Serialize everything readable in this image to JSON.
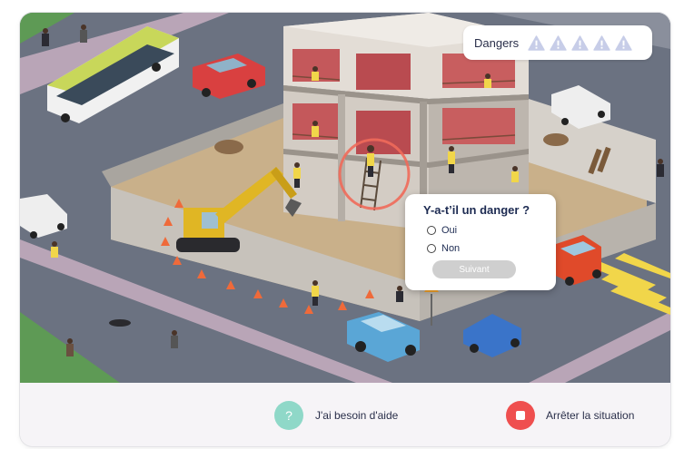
{
  "hud": {
    "label": "Dangers",
    "found": 0,
    "total": 5,
    "icon": "warning-triangle-icon",
    "icon_color": "#c7cde8"
  },
  "question": {
    "title": "Y-a-t’il un danger ?",
    "options": [
      "Oui",
      "Non"
    ],
    "selected": null,
    "next_label": "Suivant",
    "next_enabled": false
  },
  "footer": {
    "help_label": "J'ai besoin d'aide",
    "help_icon_glyph": "?",
    "help_color": "#8fd8c8",
    "stop_label": "Arrêter la situation",
    "stop_color": "#ef4f4f"
  },
  "scene": {
    "description_layer": "isometric construction site street scene",
    "highlight_color": "#ef6a5a"
  }
}
